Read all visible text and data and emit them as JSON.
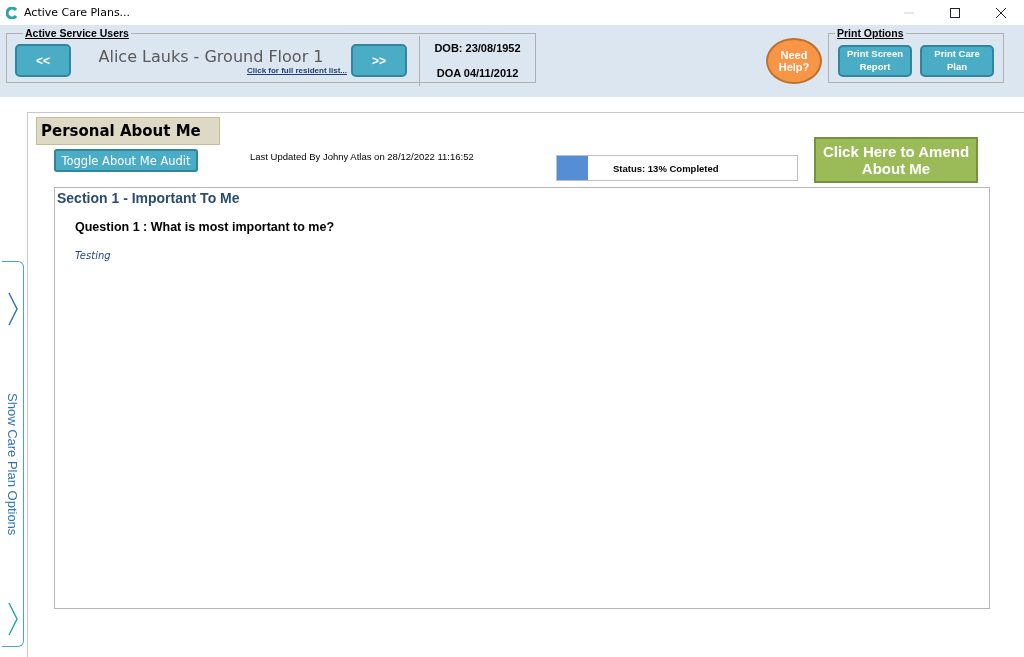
{
  "window": {
    "title": "Active Care Plans..."
  },
  "service_users": {
    "legend": "Active Service Users",
    "prev_button": "<<",
    "next_button": ">>",
    "resident_name": "Alice Lauks - Ground Floor 1",
    "resident_list_link": "Click for full resident list...",
    "dob": "DOB: 23/08/1952",
    "doa": "DOA 04/11/2012"
  },
  "help_button": "Need Help?",
  "print_options": {
    "legend": "Print Options",
    "buttons": [
      "Print Screen Report",
      "Print Care Plan"
    ]
  },
  "side_tab": {
    "label": "Show Care Plan Options"
  },
  "panel": {
    "title": "Personal About Me",
    "audit_button": "Toggle About Me Audit",
    "last_updated": "Last Updated By Johny Atlas on 28/12/2022 11:16:52",
    "status": {
      "level": 0.13,
      "label": "Status: 13% Completed"
    },
    "amend_button": "Click Here to Amend About Me",
    "section": {
      "title": "Section 1 - Important To Me",
      "questions": [
        {
          "question": "Question 1 : What is most important to me?",
          "answer": "Testing"
        }
      ]
    }
  }
}
